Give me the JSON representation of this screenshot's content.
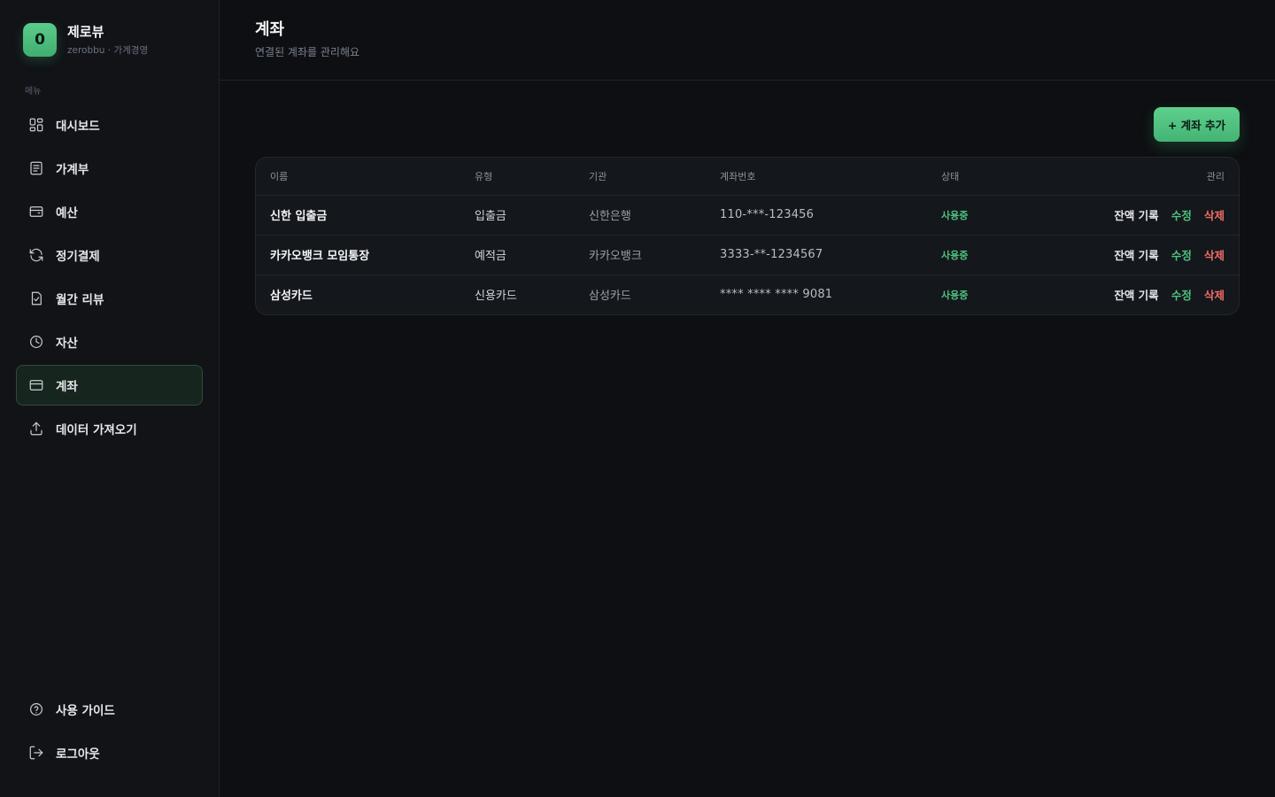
{
  "brand": {
    "logo_letter": "0",
    "name": "제로뷰",
    "subtitle": "zerobbu · 가계경영"
  },
  "sidebar": {
    "menu_label": "메뉴",
    "items": [
      {
        "label": "대시보드",
        "icon": "grid-icon"
      },
      {
        "label": "가계부",
        "icon": "document-icon"
      },
      {
        "label": "예산",
        "icon": "wallet-icon"
      },
      {
        "label": "정기결제",
        "icon": "refresh-icon"
      },
      {
        "label": "월간 리뷰",
        "icon": "clipboard-check-icon"
      },
      {
        "label": "자산",
        "icon": "pie-chart-icon"
      },
      {
        "label": "계좌",
        "icon": "credit-card-icon",
        "active": true
      },
      {
        "label": "데이터 가져오기",
        "icon": "upload-icon"
      }
    ],
    "bottom": [
      {
        "label": "사용 가이드",
        "icon": "help-circle-icon"
      },
      {
        "label": "로그아웃",
        "icon": "logout-icon"
      }
    ]
  },
  "header": {
    "title": "계좌",
    "subtitle": "연결된 계좌를 관리해요"
  },
  "toolbar": {
    "add_label": "+ 계좌 추가"
  },
  "table": {
    "columns": {
      "name": "이름",
      "type": "유형",
      "institution": "기관",
      "number": "계좌번호",
      "status": "상태",
      "manage": "관리"
    },
    "rows": [
      {
        "name": "신한 입출금",
        "type": "입출금",
        "institution": "신한은행",
        "number": "110-***-123456",
        "status": "사용중"
      },
      {
        "name": "카카오뱅크 모임통장",
        "type": "예적금",
        "institution": "카카오뱅크",
        "number": "3333-**-1234567",
        "status": "사용중"
      },
      {
        "name": "삼성카드",
        "type": "신용카드",
        "institution": "삼성카드",
        "number": "**** **** **** 9081",
        "status": "사용중"
      }
    ],
    "actions": {
      "balance": "잔액 기록",
      "edit": "수정",
      "delete": "삭제"
    }
  },
  "colors": {
    "accent": "#4fc27f",
    "danger": "#ef6d64",
    "background": "#0d0f12",
    "sidebar": "#111317"
  }
}
